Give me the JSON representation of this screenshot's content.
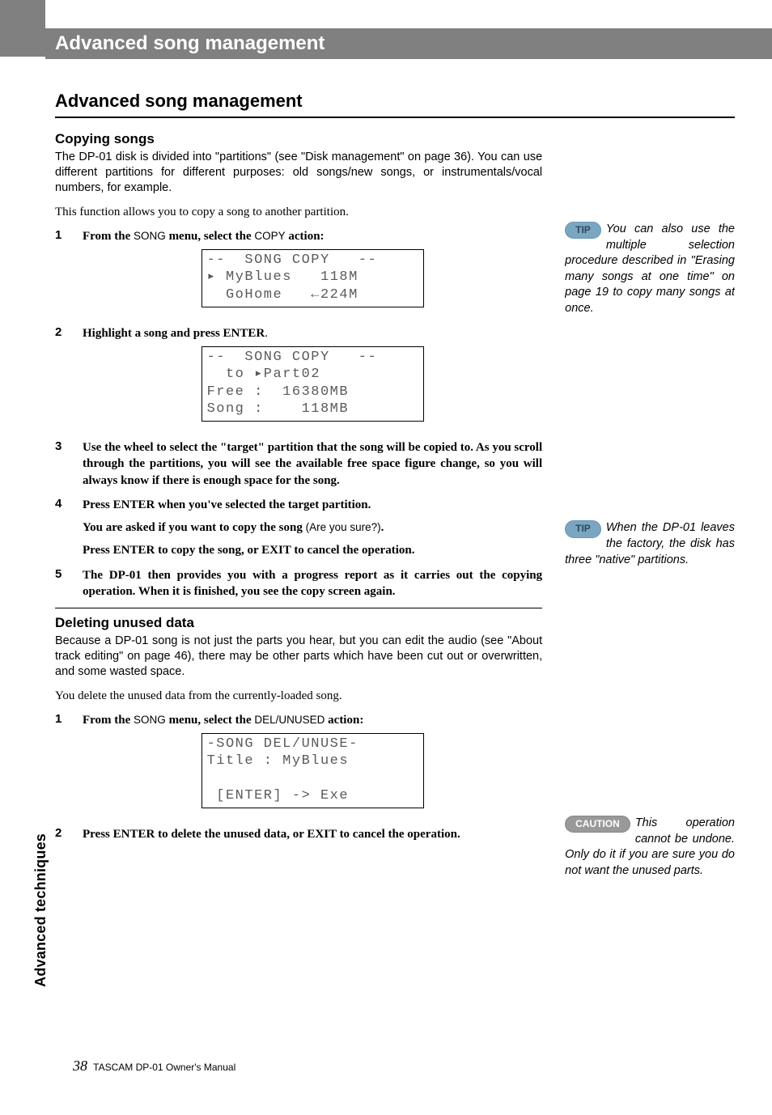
{
  "header": {
    "title": "Advanced song management"
  },
  "sidebar_label": "Advanced techniques",
  "h2": "Advanced song management",
  "section_copy": {
    "h3": "Copying songs",
    "intro": "The DP-01 disk is divided into \"partitions\" (see \"Disk management\" on page 36). You can use different partitions for different purposes: old songs/new songs, or instrumentals/vocal numbers, for example.",
    "lead": "This function allows you to copy a song to another partition.",
    "steps": {
      "s1_pre": "From the ",
      "s1_menu": "SONG",
      "s1_mid": " menu, select the ",
      "s1_action": "COPY",
      "s1_post": " action:",
      "lcd1": "--  SONG COPY   --\n▸ MyBlues   118M\n  GoHome   ←224M",
      "s2_pre": "Highlight a song and press ",
      "s2_key": "ENTER",
      "s2_post": ".",
      "lcd2": "--  SONG COPY   --\n  to ▸Part02\nFree :  16380MB\nSong :    118MB",
      "s3": "Use the wheel to select the \"target\" partition that the song will be copied to. As you scroll through the partitions, you will see the available free space figure change, so you will always know if there is enough space for the song.",
      "s4_pre": "Press ",
      "s4_key": "ENTER",
      "s4_post": " when you've selected the target partition.",
      "s4_b_pre": "You are asked if you want to copy the song ",
      "s4_b_q": "(Are you sure?)",
      "s4_b_post": ".",
      "s4_c_pre": "Press ",
      "s4_c_k1": "ENTER",
      "s4_c_mid": " to copy the song, or ",
      "s4_c_k2": "EXIT",
      "s4_c_post": " to cancel the operation.",
      "s5": "The DP-01 then provides you with a progress report as it carries out the copying operation. When it is finished, you see the copy screen again."
    }
  },
  "section_del": {
    "h3": "Deleting unused data",
    "intro": "Because a DP-01 song is not just the parts you hear, but you can edit the audio (see \"About track editing\" on page 46), there may be other parts which have been cut out or overwritten, and some wasted space.",
    "lead": "You delete the unused data from the currently-loaded song.",
    "steps": {
      "s1_pre": "From the ",
      "s1_menu": "SONG",
      "s1_mid": " menu, select the ",
      "s1_action": "DEL/UNUSED",
      "s1_post": " action:",
      "lcd": "-SONG DEL/UNUSE-\nTitle : MyBlues\n\n [ENTER] -> Exe",
      "s2_pre": "Press ",
      "s2_k1": "ENTER",
      "s2_mid": " to delete the unused data, or ",
      "s2_k2": "EXIT",
      "s2_post": " to cancel the operation."
    }
  },
  "notes": {
    "tip1_label": "TIP",
    "tip1": "You can also use the multiple selection procedure described in \"Erasing many songs at one time\" on page 19 to copy many songs at once.",
    "tip2_label": "TIP",
    "tip2": "When the DP-01 leaves the factory, the disk has three \"native\" partitions.",
    "caution_label": "CAUTION",
    "caution": "This operation cannot be undone. Only do it if you are sure you do not want the unused parts."
  },
  "footer": {
    "page": "38",
    "text": "TASCAM DP-01 Owner's Manual"
  }
}
